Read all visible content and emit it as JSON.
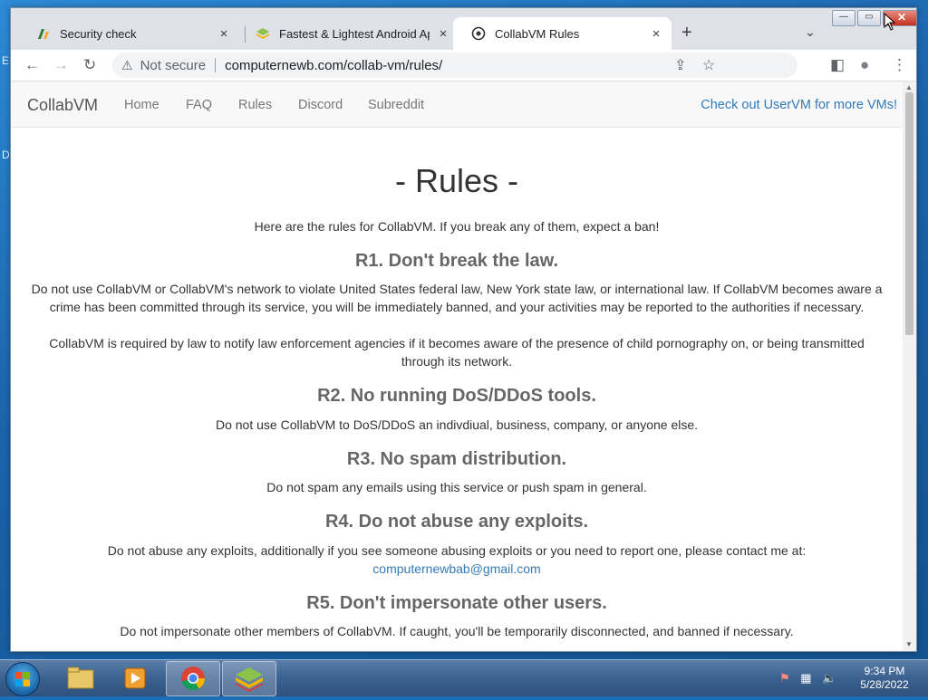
{
  "desktop": {
    "side_glyphs": [
      "E",
      "D"
    ]
  },
  "browser": {
    "tabs": [
      {
        "title": "Security check",
        "icon": "security-check-favicon",
        "active": false
      },
      {
        "title": "Fastest & Lightest Android App P",
        "icon": "bluestacks-favicon",
        "active": false
      },
      {
        "title": "CollabVM Rules",
        "icon": "collabvm-favicon",
        "active": true
      }
    ],
    "close_glyph": "×",
    "new_tab_glyph": "+",
    "tab_search_glyph": "⌄",
    "window_controls": {
      "minimize": "—",
      "maximize": "▭",
      "close": "✕"
    },
    "toolbar": {
      "back_glyph": "←",
      "forward_glyph": "→",
      "reload_glyph": "↻",
      "warning_glyph": "⚠",
      "security_label": "Not secure",
      "url": "computernewb.com/collab-vm/rules/",
      "share_glyph": "⇪",
      "bookmark_glyph": "☆",
      "sidepanel_glyph": "◧",
      "profile_glyph": "●",
      "menu_glyph": "⋮"
    }
  },
  "site": {
    "brand": "CollabVM",
    "nav": [
      "Home",
      "FAQ",
      "Rules",
      "Discord",
      "Subreddit"
    ],
    "nav_right": "Check out UserVM for more VMs!",
    "title": "- Rules -",
    "intro": "Here are the rules for CollabVM. If you break any of them, expect a ban!",
    "rules": [
      {
        "heading": "R1. Don't break the law.",
        "paragraphs": [
          "Do not use CollabVM or CollabVM's network to violate United States federal law, New York state law, or international law. If CollabVM becomes aware a crime has been committed through its service, you will be immediately banned, and your activities may be reported to the authorities if necessary.",
          "CollabVM is required by law to notify law enforcement agencies if it becomes aware of the presence of child pornography on, or being transmitted through its network."
        ]
      },
      {
        "heading": "R2. No running DoS/DDoS tools.",
        "paragraphs": [
          "Do not use CollabVM to DoS/DDoS an indivdiual, business, company, or anyone else."
        ]
      },
      {
        "heading": "R3. No spam distribution.",
        "paragraphs": [
          "Do not spam any emails using this service or push spam in general."
        ]
      },
      {
        "heading": "R4. Do not abuse any exploits.",
        "paragraphs": [
          "Do not abuse any exploits, additionally if you see someone abusing exploits or you need to report one, please contact me at:"
        ],
        "email": "computernewbab@gmail.com"
      },
      {
        "heading": "R5. Don't impersonate other users.",
        "paragraphs": [
          "Do not impersonate other members of CollabVM. If caught, you'll be temporarily disconnected, and banned if necessary."
        ]
      }
    ]
  },
  "taskbar": {
    "items": [
      "windows-explorer",
      "media-player",
      "google-chrome",
      "bluestacks"
    ],
    "clock_time": "9:34 PM",
    "clock_date": "5/28/2022"
  }
}
